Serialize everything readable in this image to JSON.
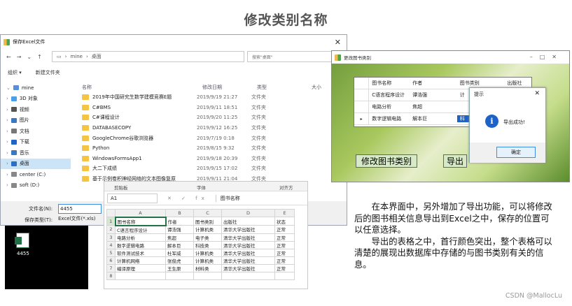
{
  "page_title": "修改类别名称",
  "save_dialog": {
    "title": "保存Excel文件",
    "path": [
      "mine",
      "桌面"
    ],
    "search_placeholder": "搜索\"桌面\"",
    "organize": "组织 ▾",
    "new_folder": "新建文件夹",
    "nav_items": [
      {
        "label": "mine",
        "color": "#5a8ed6",
        "selected": false
      },
      {
        "label": "3D 对象",
        "color": "#4aa0e8",
        "selected": false
      },
      {
        "label": "视频",
        "color": "#555555",
        "selected": false
      },
      {
        "label": "图片",
        "color": "#3b78c2",
        "selected": false
      },
      {
        "label": "文档",
        "color": "#777777",
        "selected": false
      },
      {
        "label": "下载",
        "color": "#1b65c4",
        "selected": false
      },
      {
        "label": "音乐",
        "color": "#3b78c2",
        "selected": false
      },
      {
        "label": "桌面",
        "color": "#2b70c8",
        "selected": true
      },
      {
        "label": "center (C:)",
        "color": "#888888",
        "selected": false
      },
      {
        "label": "soft (D:)",
        "color": "#888888",
        "selected": false
      }
    ],
    "columns": [
      "名称",
      "修改日期",
      "类型",
      "大小"
    ],
    "files": [
      {
        "name": "2019年中国研究生数学建模竞赛E题",
        "date": "2019/9/19 21:27",
        "type": "文件夹"
      },
      {
        "name": "C#BMS",
        "date": "2019/9/11 18:51",
        "type": "文件夹"
      },
      {
        "name": "C#课程设计",
        "date": "2019/9/20 11:25",
        "type": "文件夹"
      },
      {
        "name": "DATABASECOPY",
        "date": "2019/9/12 16:25",
        "type": "文件夹"
      },
      {
        "name": "GoogleChrome谷歌浏览器",
        "date": "2019/7/19 0:18",
        "type": "文件夹"
      },
      {
        "name": "Python",
        "date": "2019/8/15 9:32",
        "type": "文件夹"
      },
      {
        "name": "WindowsFormsApp1",
        "date": "2019/9/18 20:39",
        "type": "文件夹"
      },
      {
        "name": "大二下成绩",
        "date": "2019/9/15 17:02",
        "type": "文件夹"
      },
      {
        "name": "基于示例卷积神经网络的文本图像复原",
        "date": "2019/9/11 21:04",
        "type": "文件夹"
      }
    ],
    "filename_label": "文件名(N):",
    "filename_value": "4455",
    "filetype_label": "保存类型(T):",
    "filetype_value": "Excel文件(*.xls)"
  },
  "thumbnail": {
    "label": "4455"
  },
  "excel": {
    "ribbon": [
      "剪贴板",
      "字体",
      "对齐方"
    ],
    "cell_ref": "A1",
    "fx": "✕ ✓ fx",
    "formula": "图书名称",
    "col_headers": [
      "",
      "A",
      "B",
      "C",
      "D",
      "E"
    ],
    "rows": [
      [
        "1",
        "图书名称",
        "作者",
        "图书类别",
        "出版社",
        "状态"
      ],
      [
        "2",
        "C语言程序设计",
        "谭浩强",
        "计算机类",
        "清华大学出版社",
        "正常"
      ],
      [
        "3",
        "电路分析",
        "焦超",
        "电子类",
        "清华大学出版社",
        "正常"
      ],
      [
        "4",
        "数字逻辑电路",
        "解本巨",
        "科技类",
        "清华大学出版社",
        "正常"
      ],
      [
        "5",
        "软件测试技术",
        "杜军威",
        "计算机类",
        "清华大学出版社",
        "正常"
      ],
      [
        "6",
        "计算机网络",
        "张俊虎",
        "计算机类",
        "清华大学出版社",
        "正常"
      ],
      [
        "7",
        "编译原理",
        "王生原",
        "材料类",
        "清华大学出版社",
        "正常"
      ],
      [
        "8",
        "",
        "",
        "",
        "",
        ""
      ]
    ]
  },
  "edit_window": {
    "title": "更改图书类别",
    "grid_headers": [
      "图书名称",
      "作者",
      "图书类别",
      "出版社"
    ],
    "grid_rows": [
      [
        "C语言程序设计",
        "谭浩强",
        "计",
        ""
      ],
      [
        "电路分析",
        "焦超",
        "",
        ""
      ],
      [
        "数字逻辑电路",
        "解本巨",
        "科",
        ""
      ]
    ],
    "edit_button": "修改图书类别",
    "export_button": "导出"
  },
  "popup": {
    "title": "提示",
    "message": "导出成功!",
    "ok": "确定"
  },
  "description": [
    "在本界面中，另外增加了导出功能，可以将修改后的图书相关信息导出到Excel之中，保存的位置可以任意选择。",
    "导出的表格之中，首行颜色突出，整个表格可以清楚的展现出数据库中存储的与图书类别有关的信息。"
  ],
  "watermark": "CSDN @MallocLu"
}
